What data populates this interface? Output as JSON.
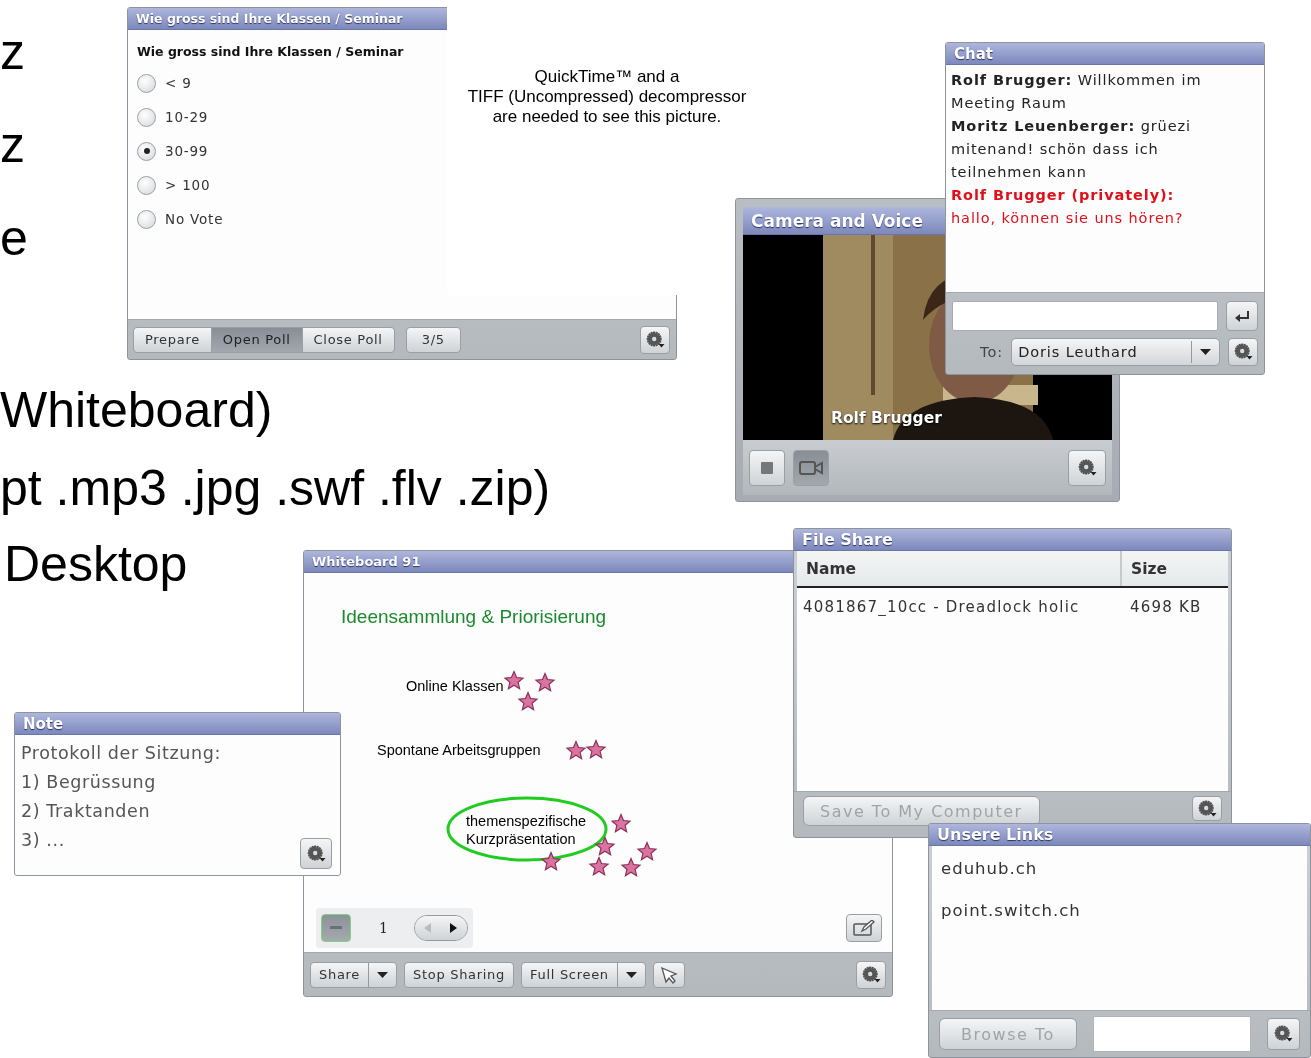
{
  "slide_bullets": [
    "z",
    "z",
    "e",
    "Whiteboard)",
    "pt .mp3 .jpg .swf .flv .zip)",
    "Desktop"
  ],
  "poll": {
    "title": "Wie gross sind Ihre Klassen / Seminar",
    "question": "Wie gross sind Ihre Klassen / Seminar",
    "options": [
      {
        "label": "< 9",
        "selected": false
      },
      {
        "label": "10-29",
        "selected": false
      },
      {
        "label": "30-99",
        "selected": true
      },
      {
        "label": "> 100",
        "selected": false
      },
      {
        "label": "No Vote",
        "selected": false
      }
    ],
    "buttons": [
      {
        "label": "Prepare",
        "selected": false
      },
      {
        "label": "Open Poll",
        "selected": true
      },
      {
        "label": "Close Poll",
        "selected": false
      }
    ],
    "counter": "3/5"
  },
  "missing_picture_notice": [
    "QuickTime™ and a",
    "TIFF (Uncompressed) decompressor",
    "are needed to see this picture."
  ],
  "camera": {
    "title": "Camera and Voice",
    "caption": "Rolf Brugger",
    "buttons": [
      {
        "kind": "stop",
        "selected": false
      },
      {
        "kind": "camera",
        "selected": true
      }
    ]
  },
  "chat": {
    "title": "Chat",
    "messages": [
      {
        "text": "**Rolf Brugger:** Willkommen im Meeting Raum",
        "private": false
      },
      {
        "text": "**Moritz Leuenberger:** grüezi mitenand! schön dass ich teilnehmen kann",
        "private": false
      },
      {
        "text": "**Rolf Brugger (privately):** hallo, können sie uns hören?",
        "private": true
      }
    ],
    "to_label": "To:",
    "recipient": "Doris Leuthard"
  },
  "whiteboard": {
    "title": "Whiteboard 91",
    "heading": "Ideensammlung & Priorisierung",
    "items": [
      {
        "text": "Online Klassen",
        "circled": false,
        "stickers": [
          {
            "kind": "star"
          },
          {
            "kind": "star"
          },
          {
            "kind": "star"
          }
        ]
      },
      {
        "text": "Spontane Arbeitsgruppen",
        "circled": false,
        "stickers": [
          {
            "kind": "star"
          },
          {
            "kind": "star"
          }
        ]
      },
      {
        "text": "themenspezifische\nKurzpräsentation",
        "circled": true,
        "stickers": [
          {
            "kind": "star"
          },
          {
            "kind": "star"
          },
          {
            "kind": "star"
          },
          {
            "kind": "star"
          },
          {
            "kind": "star"
          },
          {
            "kind": "star"
          }
        ]
      }
    ],
    "page": "1",
    "toolbar": [
      {
        "label": "Share",
        "dropdown": true
      },
      {
        "label": "Stop Sharing",
        "dropdown": false
      },
      {
        "label": "Full Screen",
        "dropdown": true
      }
    ]
  },
  "note": {
    "title": "Note",
    "lines": [
      "Protokoll der Sitzung:",
      "1) Begrüssung",
      "2) Traktanden",
      "3) ..."
    ]
  },
  "file_share": {
    "title": "File Share",
    "columns": [
      "Name",
      "Size"
    ],
    "rows": [
      [
        "4081867_10cc - Dreadlock holic",
        "4698 KB"
      ]
    ],
    "button": {
      "label": "Save To My Computer",
      "disabled": true
    }
  },
  "links": {
    "title": "Unsere Links",
    "items": [
      "eduhub.ch",
      "point.switch.ch"
    ],
    "button": {
      "label": "Browse To",
      "disabled": true
    }
  }
}
